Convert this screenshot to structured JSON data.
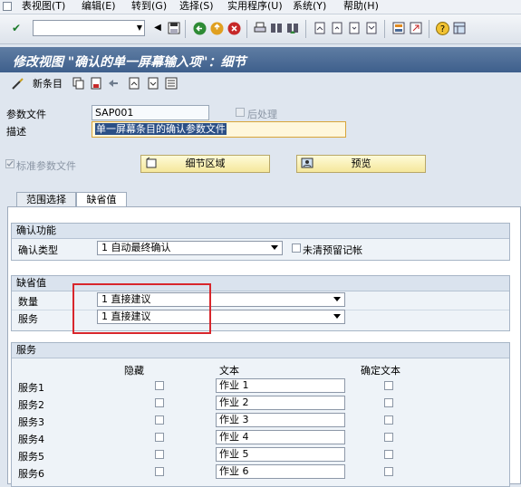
{
  "menu": [
    "表视图(T)",
    "编辑(E)",
    "转到(G)",
    "选择(S)",
    "实用程序(U)",
    "系统(Y)",
    "帮助(H)"
  ],
  "toolbar": {
    "command_field_value": "",
    "icons": [
      "enter-icon",
      "save-icon",
      "back-icon",
      "exit-icon",
      "cancel-icon",
      "print-icon",
      "find-icon",
      "find-next-icon",
      "first-page-icon",
      "previous-page-icon",
      "next-page-icon",
      "last-page-icon",
      "create-session-icon",
      "shortcut-icon",
      "help-icon",
      "layout-icon"
    ]
  },
  "title": "修改视图 \"确认的单一屏幕输入项\"：细节",
  "app_toolbar": {
    "new_entries_label": "新条目",
    "icons": [
      "copy-icon",
      "delete-icon",
      "undo-icon",
      "previous-entry-icon",
      "next-entry-icon",
      "transport-icon"
    ]
  },
  "header": {
    "param_file_label": "参数文件",
    "param_file_value": "SAP001",
    "post_process_label": "后处理",
    "post_process_checked": false,
    "description_label": "描述",
    "description_value": "单一屏幕条目的确认参数文件",
    "standard_param_label": "标准参数文件",
    "standard_param_checked": true,
    "detail_area_button": "细节区域",
    "preview_button": "预览"
  },
  "tabs": [
    {
      "label": "范围选择",
      "active": false
    },
    {
      "label": "缺省值",
      "active": true
    }
  ],
  "confirm_group": {
    "title": "确认功能",
    "type_label": "确认类型",
    "type_value": "1 自动最终确认",
    "no_reservation_label": "未清预留记帐",
    "no_reservation_checked": false
  },
  "default_group": {
    "title": "缺省值",
    "quantity_label": "数量",
    "quantity_value": "1 直接建议",
    "service_label": "服务",
    "service_value": "1 直接建议"
  },
  "services_group": {
    "title": "服务",
    "col_hidden": "隐藏",
    "col_text": "文本",
    "col_confirm_text": "确定文本",
    "rows": [
      {
        "label": "服务1",
        "text": "作业 1",
        "hidden": false,
        "confirm": false
      },
      {
        "label": "服务2",
        "text": "作业 2",
        "hidden": false,
        "confirm": false
      },
      {
        "label": "服务3",
        "text": "作业 3",
        "hidden": false,
        "confirm": false
      },
      {
        "label": "服务4",
        "text": "作业 4",
        "hidden": false,
        "confirm": false
      },
      {
        "label": "服务5",
        "text": "作业 5",
        "hidden": false,
        "confirm": false
      },
      {
        "label": "服务6",
        "text": "作业 6",
        "hidden": false,
        "confirm": false
      }
    ]
  },
  "colors": {
    "title_bar": "#4a6a96",
    "button_yellow": "#f5e79b",
    "highlight_box": "#d8262c",
    "selected_text_bg": "#2b4f86"
  }
}
